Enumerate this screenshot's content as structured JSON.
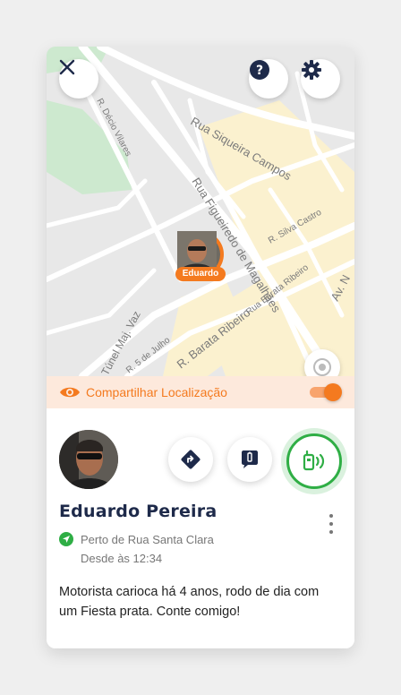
{
  "map": {
    "streets": [
      "Rua Siqueira Campos",
      "R. Décio Vilares",
      "Rua Figueiredo de Magalhães",
      "R. Silva Castro",
      "Av. N",
      "Túnel Maj. Vaz",
      "R. 5 de Julho",
      "R. Barata Ribeiro",
      "Rua Barata Ribeiro"
    ],
    "driver_marker_label": "Eduardo"
  },
  "top_bar": {
    "close_icon": "close-icon",
    "help_icon": "help-icon",
    "settings_icon": "gear-icon"
  },
  "share": {
    "label": "Compartilhar Localização",
    "enabled": true,
    "accent_color": "#f47a1f"
  },
  "driver": {
    "name": "Eduardo Pereira",
    "location": "Perto de Rua Santa Clara",
    "since": "Desde às 12:34",
    "bio": "Motorista carioca há 4 anos, rodo de dia com um Fiesta prata. Conte comigo!"
  },
  "actions": {
    "directions_icon": "directions-icon",
    "message_icon": "message-icon",
    "call_icon": "radio-call-icon",
    "call_color": "#2fae45"
  }
}
